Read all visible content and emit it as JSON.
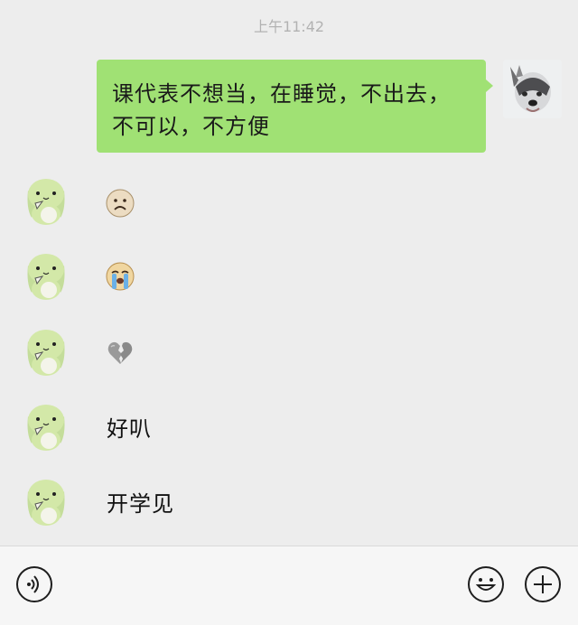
{
  "chat": {
    "timestamp": "上午11:42",
    "messages": [
      {
        "from": "me",
        "type": "text",
        "text": "课代表不想当，在睡觉，不出去，不可以，不方便"
      },
      {
        "from": "friend",
        "type": "emoji",
        "icon": "frowning-face-icon"
      },
      {
        "from": "friend",
        "type": "emoji",
        "icon": "loudly-crying-face-icon"
      },
      {
        "from": "friend",
        "type": "emoji",
        "icon": "broken-heart-icon"
      },
      {
        "from": "friend",
        "type": "text",
        "text": "好叭"
      },
      {
        "from": "friend",
        "type": "text",
        "text": "开学见"
      }
    ]
  },
  "colors": {
    "background": "#ededed",
    "my_bubble": "#a0e174",
    "bottom_bar": "#f6f6f6"
  },
  "toolbar": {
    "left_icon": "voice-icon",
    "right_icons": [
      "emoji-icon",
      "plus-icon"
    ]
  }
}
